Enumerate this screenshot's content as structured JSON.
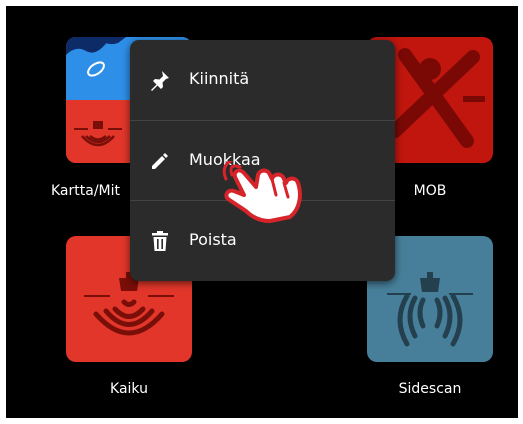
{
  "apps": {
    "chart": {
      "label": "Kartta/Mit"
    },
    "mob": {
      "label": "MOB"
    },
    "echo": {
      "label": "Kaiku"
    },
    "sidescan": {
      "label": "Sidescan"
    }
  },
  "context_menu": {
    "items": [
      {
        "label": "Kiinnitä",
        "icon": "pin-icon"
      },
      {
        "label": "Muokkaa",
        "icon": "pencil-icon"
      },
      {
        "label": "Poista",
        "icon": "trash-icon"
      }
    ]
  },
  "colors": {
    "screen_bg": "#000000",
    "menu_bg": "#2b2b2b",
    "red": "#e2362a",
    "dark_red": "#c0160e",
    "blue": "#2e8fe8",
    "steel_blue": "#477f9a",
    "cursor": "#d6242a"
  }
}
